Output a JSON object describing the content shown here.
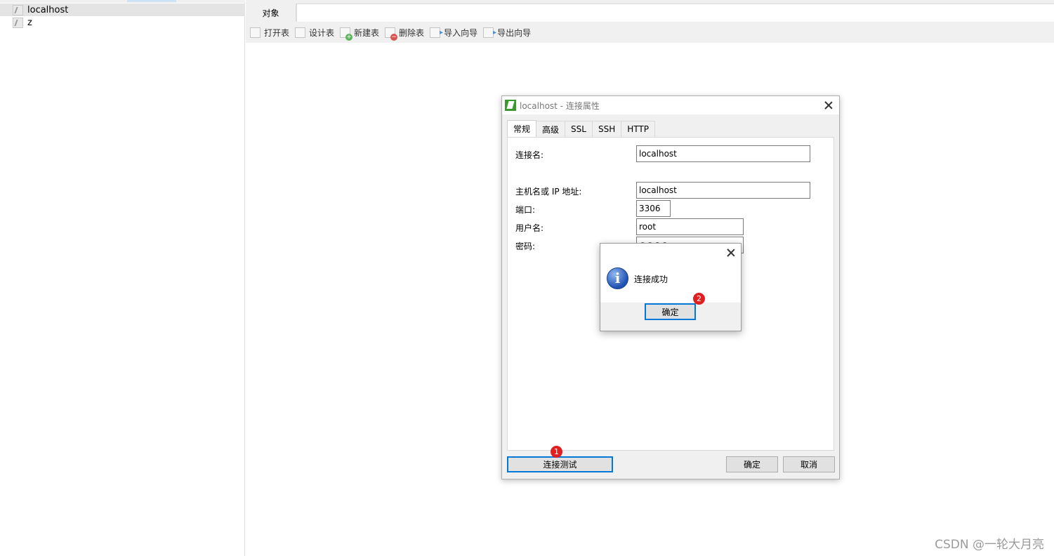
{
  "tree": {
    "items": [
      {
        "label": "localhost",
        "icon": "db-connection-icon",
        "selected": true
      },
      {
        "label": "z",
        "icon": "db-connection-icon",
        "selected": false
      }
    ]
  },
  "object_tab": {
    "label": "对象"
  },
  "toolbar": {
    "buttons": [
      {
        "label": "打开表",
        "icon": "open-table-icon"
      },
      {
        "label": "设计表",
        "icon": "design-table-icon"
      },
      {
        "label": "新建表",
        "icon": "new-table-icon"
      },
      {
        "label": "删除表",
        "icon": "delete-table-icon"
      },
      {
        "label": "导入向导",
        "icon": "import-wizard-icon"
      },
      {
        "label": "导出向导",
        "icon": "export-wizard-icon"
      }
    ]
  },
  "conn_dialog": {
    "title": "localhost - 连接属性",
    "tabs": [
      "常规",
      "高级",
      "SSL",
      "SSH",
      "HTTP"
    ],
    "active_tab": 0,
    "fields": {
      "conn_name_label": "连接名:",
      "conn_name_value": "localhost",
      "host_label": "主机名或 IP 地址:",
      "host_value": "localhost",
      "port_label": "端口:",
      "port_value": "3306",
      "user_label": "用户名:",
      "user_value": "root",
      "password_label": "密码:",
      "password_value": "●●●●"
    },
    "test_button": "连接测试",
    "ok_button": "确定",
    "cancel_button": "取消"
  },
  "msgbox": {
    "message": "连接成功",
    "ok_button": "确定",
    "icon": "info-icon"
  },
  "badges": {
    "one": "1",
    "two": "2"
  },
  "watermark": "CSDN @一轮大月亮",
  "colors": {
    "accent": "#0078d7",
    "badge": "#e02020",
    "app_icon": "#3b9a2e"
  }
}
